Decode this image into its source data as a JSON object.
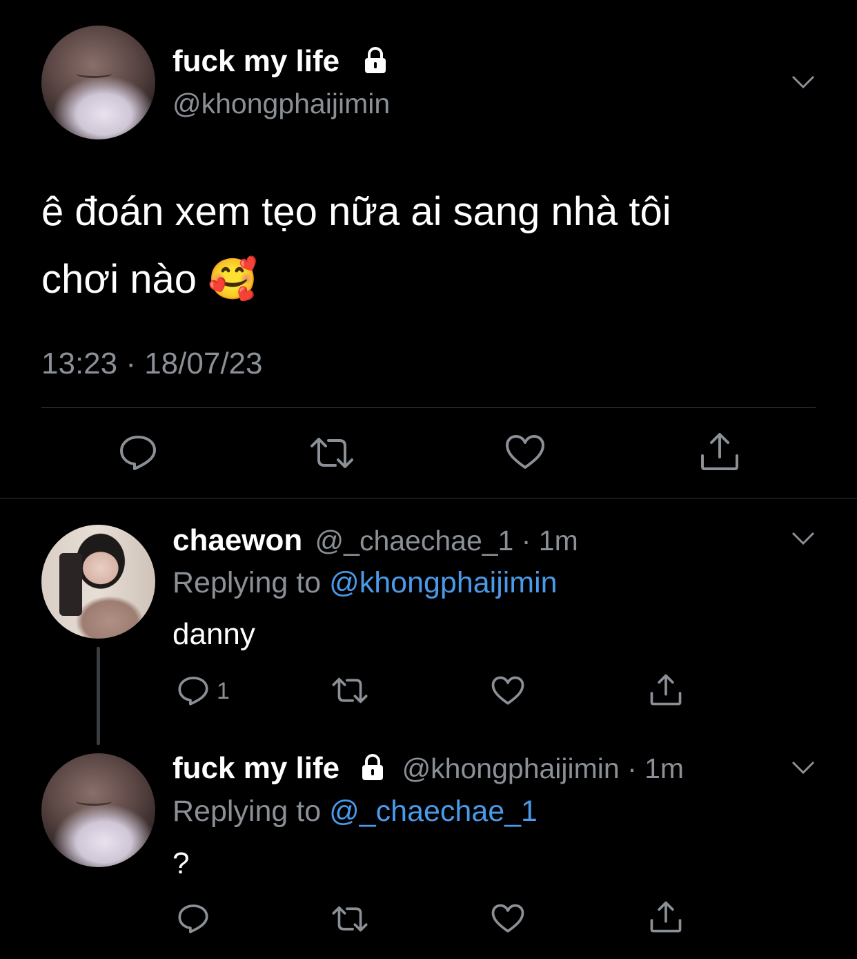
{
  "main_tweet": {
    "display_name": "fuck my life",
    "handle": "@khongphaijimin",
    "text_line1": "ê đoán xem tẹo nữa ai sang nhà tôi",
    "text_line2": "chơi nào",
    "emoji": "🥰",
    "timestamp": "13:23 · 18/07/23"
  },
  "reply1": {
    "display_name": "chaewon",
    "meta": "@_chaechae_1 · 1m",
    "replying_prefix": "Replying to",
    "replying_to": "@khongphaijimin",
    "text": "danny",
    "reply_count": "1"
  },
  "reply2": {
    "display_name": "fuck my life",
    "meta": "@khongphaijimin · 1m",
    "replying_prefix": "Replying to",
    "replying_to": "@_chaechae_1",
    "text": "?"
  },
  "icons": [
    "reply-icon",
    "retweet-icon",
    "like-icon",
    "share-icon",
    "lock-icon",
    "chevron-down-icon"
  ],
  "colors": {
    "background": "#000000",
    "text": "#ffffff",
    "muted": "#8b9097",
    "link": "#4a9ae9",
    "divider": "#2f3336"
  }
}
